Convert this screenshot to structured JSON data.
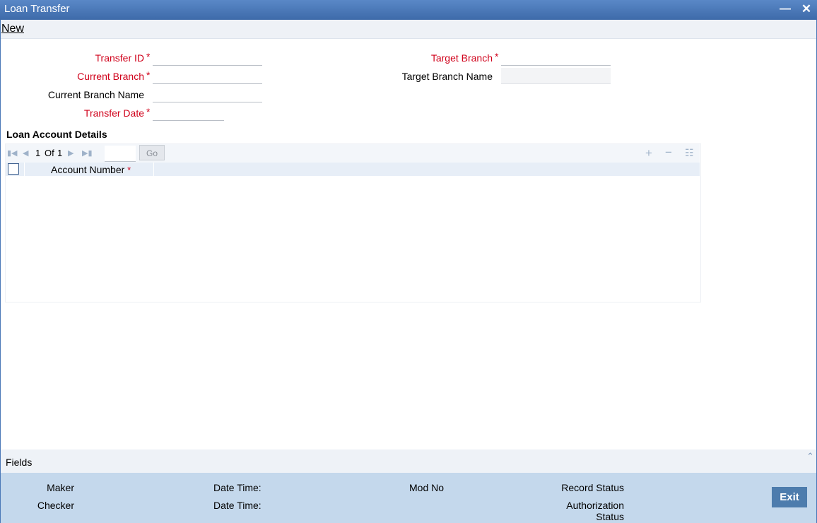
{
  "window": {
    "title": "Loan Transfer",
    "minimize_glyph": "▬",
    "close_glyph": "✕"
  },
  "toolbar": {
    "new_label": "New"
  },
  "form": {
    "transfer_id_label": "Transfer ID",
    "current_branch_label": "Current Branch",
    "current_branch_name_label": "Current Branch Name",
    "transfer_date_label": "Transfer Date",
    "target_branch_label": "Target Branch",
    "target_branch_name_label": "Target Branch Name",
    "required_marker": "*",
    "transfer_id_value": "",
    "current_branch_value": "",
    "current_branch_name_value": "",
    "transfer_date_value": "",
    "target_branch_value": "",
    "target_branch_name_value": ""
  },
  "loan_details": {
    "title": "Loan Account Details",
    "pager": {
      "current": "1",
      "of_label": "Of",
      "total": "1",
      "page_input": "",
      "go_label": "Go"
    },
    "columns": [
      {
        "label": "Account Number",
        "required": "*"
      }
    ],
    "rows": [],
    "icons": [
      "first-page-icon",
      "prev-page-icon",
      "next-page-icon",
      "last-page-icon",
      "add-row-icon",
      "delete-row-icon",
      "view-row-icon"
    ]
  },
  "footer": {
    "fields_label": "Fields",
    "maker_label": "Maker",
    "checker_label": "Checker",
    "date_time_label": "Date Time:",
    "mod_no_label": "Mod No",
    "record_status_label": "Record Status",
    "authorization_label": "Authorization",
    "status_label": "Status",
    "exit_label": "Exit"
  },
  "colors": {
    "title_bar": "#4a78b7",
    "required_text": "#d0021b",
    "audit_bg": "#c4d8ec",
    "exit_button": "#4d7cad"
  }
}
